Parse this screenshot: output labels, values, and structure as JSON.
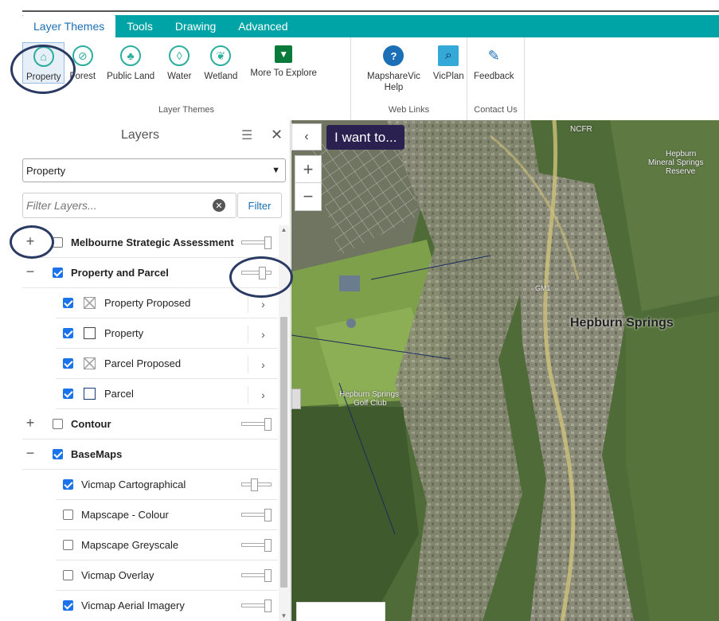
{
  "tabs": [
    {
      "label": "Layer Themes",
      "active": true
    },
    {
      "label": "Tools",
      "active": false
    },
    {
      "label": "Drawing",
      "active": false
    },
    {
      "label": "Advanced",
      "active": false
    }
  ],
  "ribbon": {
    "layer_themes": {
      "label": "Layer Themes",
      "items": [
        {
          "label": "Property",
          "icon": "house-icon",
          "selected": true
        },
        {
          "label": "Forest",
          "icon": "forest-icon"
        },
        {
          "label": "Public Land",
          "icon": "tree-icon"
        },
        {
          "label": "Water",
          "icon": "water-drop-icon"
        },
        {
          "label": "Wetland",
          "icon": "leaf-icon"
        },
        {
          "label": "More To Explore",
          "icon": "explore-icon"
        }
      ]
    },
    "web_links": {
      "label": "Web Links",
      "items": [
        {
          "label": "MapshareVic",
          "label2": "Help",
          "icon": "help-icon"
        },
        {
          "label": "VicPlan",
          "icon": "magnify-icon"
        }
      ]
    },
    "contact": {
      "label": "Contact Us",
      "items": [
        {
          "label": "Feedback",
          "icon": "feedback-icon"
        }
      ]
    }
  },
  "panel": {
    "title": "Layers",
    "theme_selected": "Property",
    "filter_placeholder": "Filter Layers...",
    "filter_button": "Filter"
  },
  "layers": [
    {
      "name": "Melbourne Strategic Assessment",
      "group": true,
      "toggle": "+",
      "checked": false,
      "slider": 1.0
    },
    {
      "name": "Property and Parcel",
      "group": true,
      "toggle": "−",
      "checked": true,
      "slider": 0.75
    },
    {
      "name": "Property Proposed",
      "child": true,
      "checked": true,
      "legend": "cross"
    },
    {
      "name": "Property",
      "child": true,
      "checked": true,
      "legend": "box"
    },
    {
      "name": "Parcel Proposed",
      "child": true,
      "checked": true,
      "legend": "cross"
    },
    {
      "name": "Parcel",
      "child": true,
      "checked": true,
      "legend": "box-blue"
    },
    {
      "name": "Contour",
      "group": true,
      "toggle": "+",
      "checked": false,
      "slider": 1.0
    },
    {
      "name": "BaseMaps",
      "group": true,
      "toggle": "−",
      "checked": true
    },
    {
      "name": "Vicmap Cartographical",
      "sub": true,
      "checked": true,
      "slider": 0.4
    },
    {
      "name": "Mapscape - Colour",
      "sub": true,
      "checked": false,
      "slider": 1.0
    },
    {
      "name": "Mapscape Greyscale",
      "sub": true,
      "checked": false,
      "slider": 1.0
    },
    {
      "name": "Vicmap Overlay",
      "sub": true,
      "checked": false,
      "slider": 1.0
    },
    {
      "name": "Vicmap Aerial Imagery",
      "sub": true,
      "checked": true,
      "slider": 1.0
    }
  ],
  "map": {
    "i_want_to": "I want to...",
    "zoom_in": "+",
    "zoom_out": "−",
    "collapse": "‹",
    "labels": {
      "town": "Hepburn Springs",
      "reserve1": "Hepburn",
      "reserve2": "Mineral Springs",
      "reserve3": "Reserve",
      "golf1": "Hepburn Springs",
      "golf2": "Golf Club",
      "ncfr": "NCFR",
      "gm1": "GM1"
    }
  },
  "colors": {
    "tab_bar": "#00a4a6",
    "accent": "#1b6fb5",
    "annotation": "#2b3a63"
  }
}
